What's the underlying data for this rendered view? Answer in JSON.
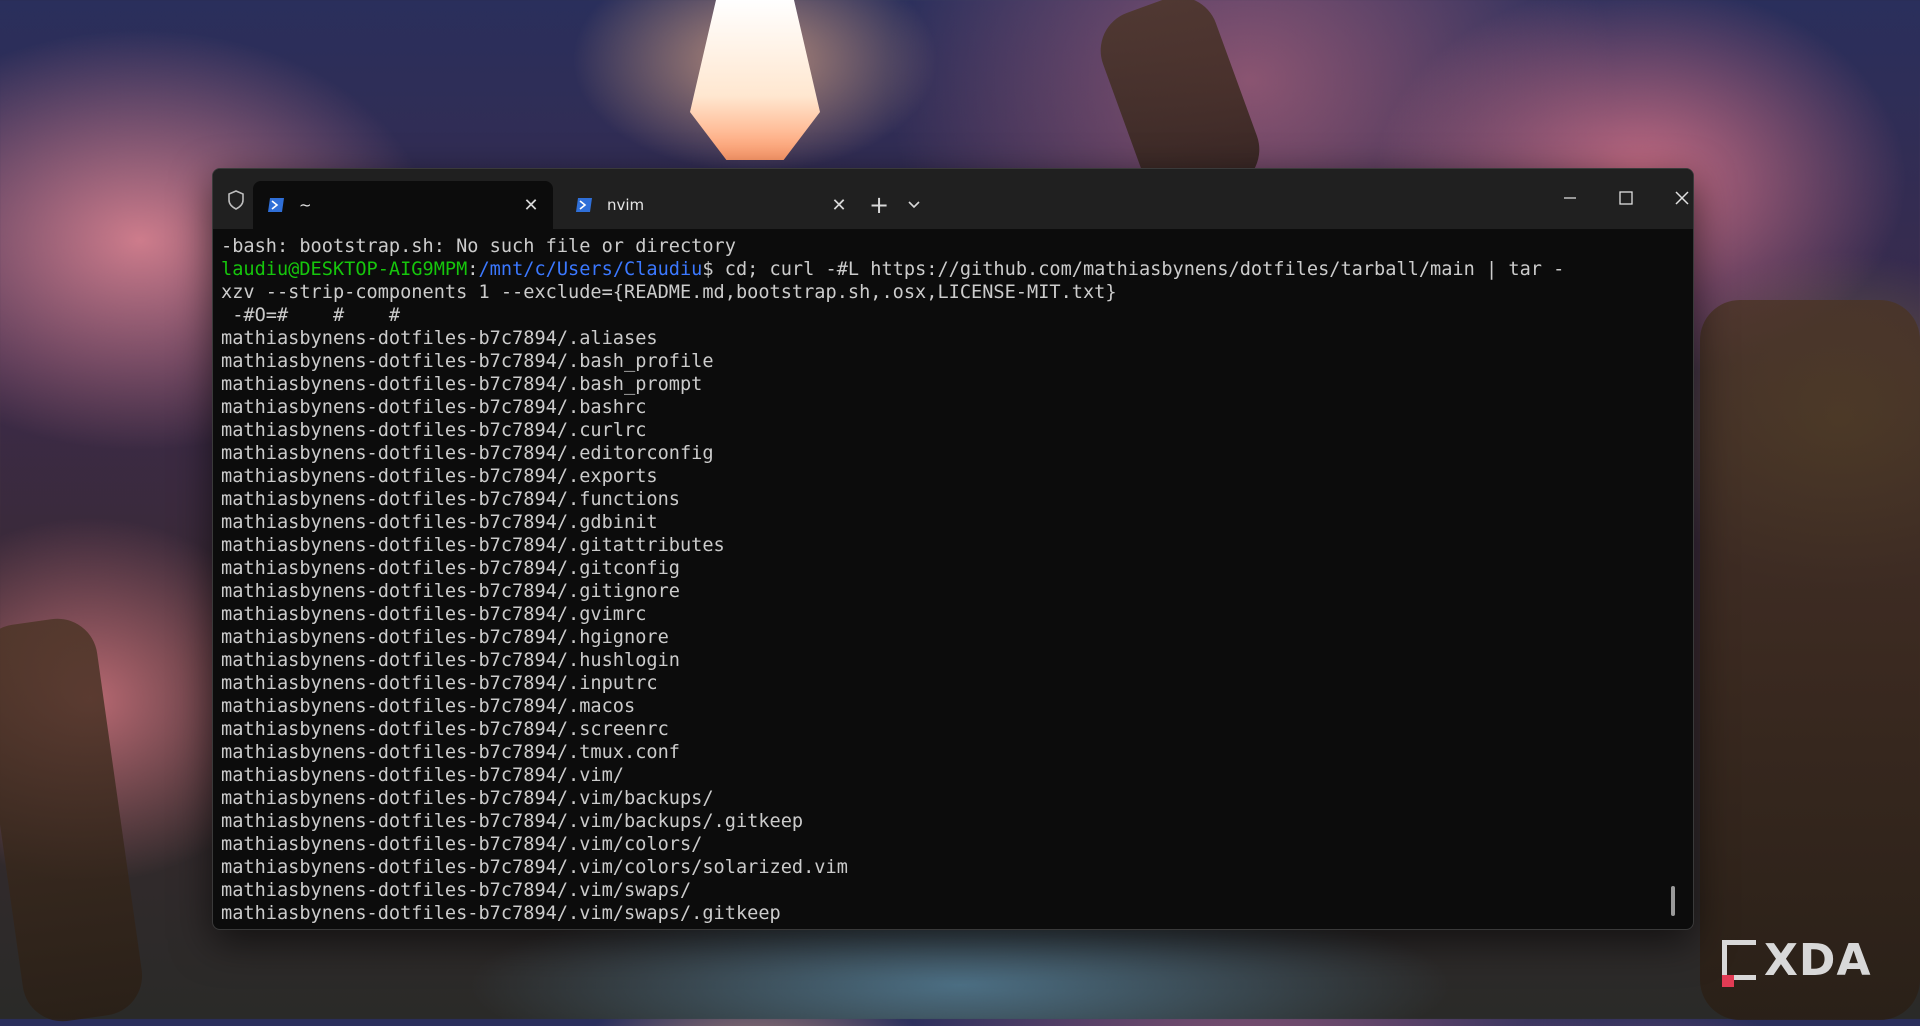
{
  "tabs": [
    {
      "title": "~",
      "active": true,
      "icon": "powershell-icon"
    },
    {
      "title": "nvim",
      "active": false,
      "icon": "powershell-icon"
    }
  ],
  "titlebar": {
    "shield_icon": "shield-icon",
    "new_tab_label": "+",
    "dropdown_icon": "chevron-down-icon",
    "window_controls": [
      "minimize-icon",
      "maximize-icon",
      "close-icon"
    ]
  },
  "terminal": {
    "error_line": "-bash: bootstrap.sh: No such file or directory",
    "prompt_user": "laudiu@DESKTOP-AIG9MPM",
    "prompt_colon": ":",
    "prompt_path": "/mnt/c/Users/Claudiu",
    "prompt_command": "$ cd; curl -#L https://github.com/mathiasbynens/dotfiles/tarball/main | tar -",
    "command_wrap": "xzv --strip-components 1 --exclude={README.md,bootstrap.sh,.osx,LICENSE-MIT.txt}",
    "progress_line": " -#O=#    #    #",
    "output_lines": [
      "mathiasbynens-dotfiles-b7c7894/.aliases",
      "mathiasbynens-dotfiles-b7c7894/.bash_profile",
      "mathiasbynens-dotfiles-b7c7894/.bash_prompt",
      "mathiasbynens-dotfiles-b7c7894/.bashrc",
      "mathiasbynens-dotfiles-b7c7894/.curlrc",
      "mathiasbynens-dotfiles-b7c7894/.editorconfig",
      "mathiasbynens-dotfiles-b7c7894/.exports",
      "mathiasbynens-dotfiles-b7c7894/.functions",
      "mathiasbynens-dotfiles-b7c7894/.gdbinit",
      "mathiasbynens-dotfiles-b7c7894/.gitattributes",
      "mathiasbynens-dotfiles-b7c7894/.gitconfig",
      "mathiasbynens-dotfiles-b7c7894/.gitignore",
      "mathiasbynens-dotfiles-b7c7894/.gvimrc",
      "mathiasbynens-dotfiles-b7c7894/.hgignore",
      "mathiasbynens-dotfiles-b7c7894/.hushlogin",
      "mathiasbynens-dotfiles-b7c7894/.inputrc",
      "mathiasbynens-dotfiles-b7c7894/.macos",
      "mathiasbynens-dotfiles-b7c7894/.screenrc",
      "mathiasbynens-dotfiles-b7c7894/.tmux.conf",
      "mathiasbynens-dotfiles-b7c7894/.vim/",
      "mathiasbynens-dotfiles-b7c7894/.vim/backups/",
      "mathiasbynens-dotfiles-b7c7894/.vim/backups/.gitkeep",
      "mathiasbynens-dotfiles-b7c7894/.vim/colors/",
      "mathiasbynens-dotfiles-b7c7894/.vim/colors/solarized.vim",
      "mathiasbynens-dotfiles-b7c7894/.vim/swaps/",
      "mathiasbynens-dotfiles-b7c7894/.vim/swaps/.gitkeep"
    ]
  },
  "watermark": {
    "text": "XDA"
  },
  "colors": {
    "prompt_user": "#16c60c",
    "prompt_path": "#3b78ff",
    "terminal_bg": "#0c0c0c",
    "titlebar_bg": "#202020",
    "text": "#cccccc",
    "logo_accent": "#e13b54"
  }
}
